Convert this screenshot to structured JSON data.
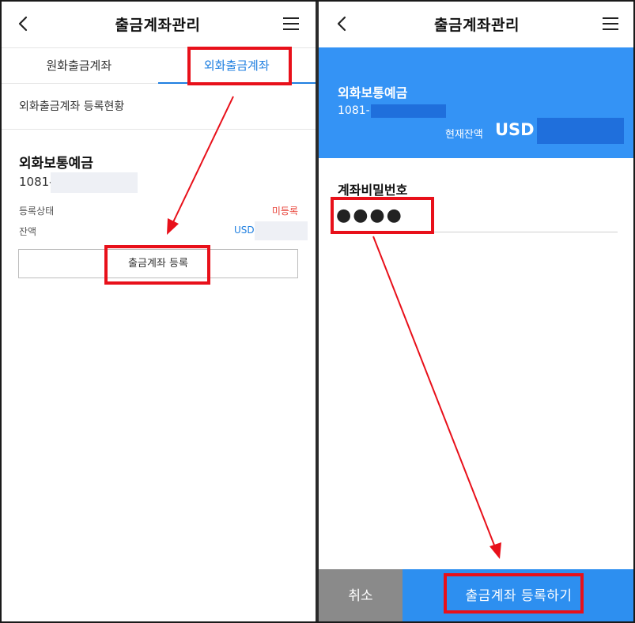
{
  "left": {
    "header": {
      "title": "출금계좌관리",
      "back_icon": "chevron-left-icon",
      "menu_icon": "hamburger-menu-icon"
    },
    "tabs": [
      {
        "label": "원화출금계좌",
        "active": false
      },
      {
        "label": "외화출금계좌",
        "active": true
      }
    ],
    "section_title": "외화출금계좌 등록현황",
    "account": {
      "name": "외화보통예금",
      "number_prefix": "1081-",
      "status_label": "등록상태",
      "status_value": "미등록",
      "balance_label": "잔액",
      "balance_currency": "USD"
    },
    "register_button": "출금계좌 등록"
  },
  "right": {
    "header": {
      "title": "출금계좌관리",
      "back_icon": "chevron-left-icon",
      "menu_icon": "hamburger-menu-icon"
    },
    "account": {
      "name": "외화보통예금",
      "number_prefix": "1081-",
      "balance_label": "현재잔액",
      "balance_currency": "USD"
    },
    "password_label": "계좌비밀번호",
    "password_value": "●●●●",
    "cancel_button": "취소",
    "register_button": "출금계좌 등록하기"
  },
  "colors": {
    "accent_blue": "#1f7fe0",
    "card_blue": "#3493f5",
    "footer_blue": "#2d8ff0",
    "cancel_gray": "#8a8a8a",
    "status_red": "#e8453c",
    "annotation_red": "#e8101a"
  }
}
